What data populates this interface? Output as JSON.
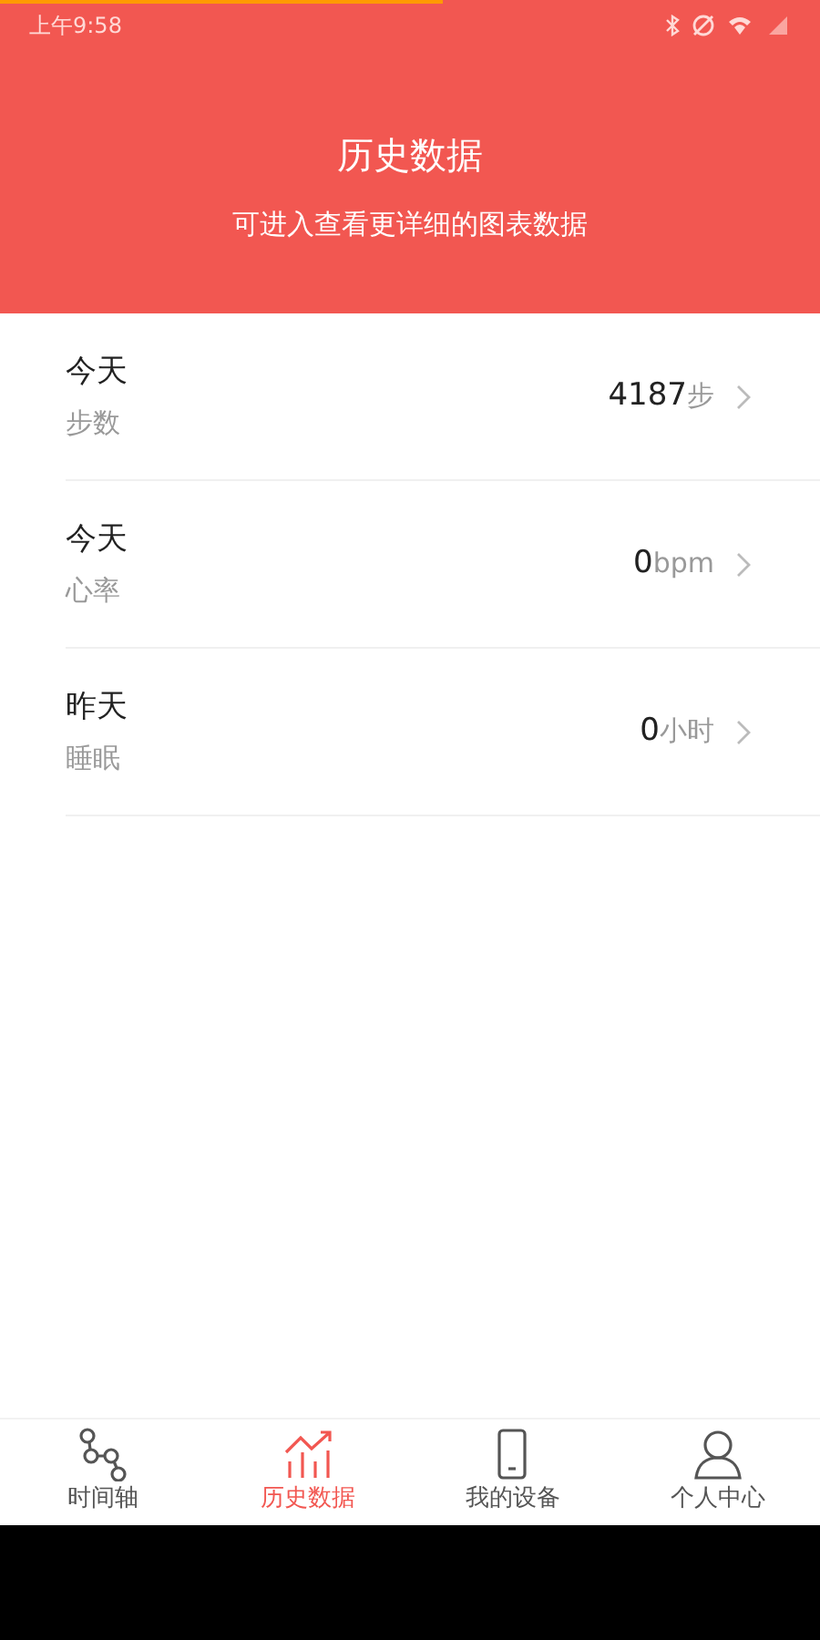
{
  "loading_bar": {
    "level": 0.54
  },
  "status_bar": {
    "time": "上午9:58"
  },
  "header": {
    "title": "历史数据",
    "subtitle": "可进入查看更详细的图表数据"
  },
  "rows": [
    {
      "day": "今天",
      "label": "步数",
      "value": "4187",
      "unit": "步"
    },
    {
      "day": "今天",
      "label": "心率",
      "value": "0",
      "unit": "bpm"
    },
    {
      "day": "昨天",
      "label": "睡眠",
      "value": "0",
      "unit": "小时"
    }
  ],
  "tabs": [
    {
      "label": "时间轴",
      "selected": false
    },
    {
      "label": "历史数据",
      "selected": true
    },
    {
      "label": "我的设备",
      "selected": false
    },
    {
      "label": "个人中心",
      "selected": false
    }
  ]
}
